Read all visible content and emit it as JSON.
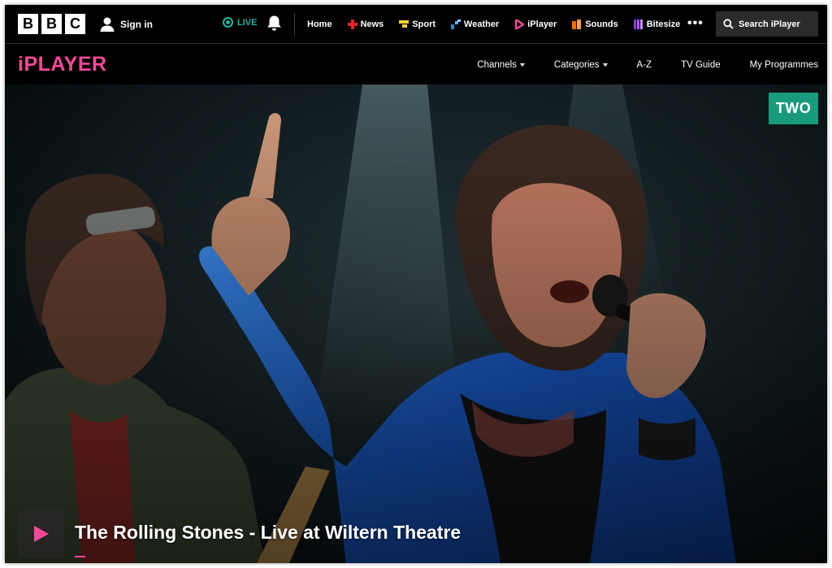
{
  "bbc_bar": {
    "logo_letters": [
      "B",
      "B",
      "C"
    ],
    "signin_label": "Sign in",
    "live_label": "LIVE",
    "nav": [
      {
        "label": "Home",
        "icon": "",
        "color": ""
      },
      {
        "label": "News",
        "icon": "news-icon",
        "color": "#e3242b"
      },
      {
        "label": "Sport",
        "icon": "sport-icon",
        "color": "#ffd230"
      },
      {
        "label": "Weather",
        "icon": "weather-icon",
        "color": "#3b82c4"
      },
      {
        "label": "iPlayer",
        "icon": "iplayer-icon",
        "color": "#f54997"
      },
      {
        "label": "Sounds",
        "icon": "sounds-icon",
        "color": "#ff6a00"
      },
      {
        "label": "Bitesize",
        "icon": "bitesize-icon",
        "color": "#8b3fd6"
      }
    ],
    "more_label": "•••",
    "search_label": "Search iPlayer"
  },
  "iplayer_bar": {
    "logo": "iPLAYER",
    "logo_color": "#f54997",
    "nav": [
      {
        "label": "Channels",
        "dropdown": true
      },
      {
        "label": "Categories",
        "dropdown": true
      },
      {
        "label": "A-Z",
        "dropdown": false
      },
      {
        "label": "TV Guide",
        "dropdown": false
      },
      {
        "label": "My Programmes",
        "dropdown": false
      }
    ]
  },
  "hero": {
    "channel_badge": "TWO",
    "channel_color": "#1a9a7c",
    "title": "The Rolling Stones - Live at Wiltern Theatre",
    "play_icon_color": "#f54997",
    "progress_color": "#f54997"
  }
}
